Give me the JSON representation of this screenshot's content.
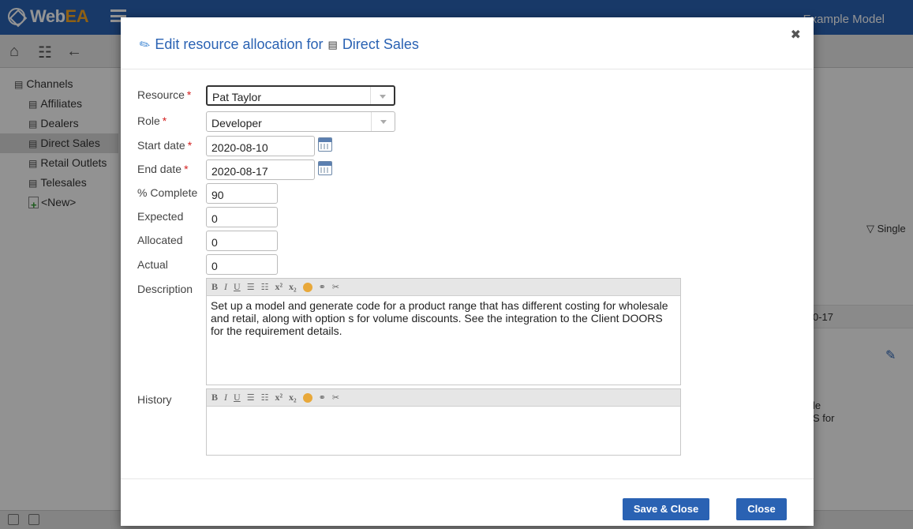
{
  "app": {
    "brand_web": "Web",
    "brand_ea": "EA",
    "model_name": "Example Model"
  },
  "tree": {
    "root": "Channels",
    "items": [
      "Affiliates",
      "Dealers",
      "Direct Sales",
      "Retail Outlets",
      "Telesales"
    ],
    "selected": "Direct Sales",
    "new_label": "<New>"
  },
  "right_pane": {
    "filter_label": "Single",
    "date_fragment": "0-17",
    "text_line1": "le",
    "text_line2": "S for"
  },
  "modal": {
    "title_prefix": "Edit resource allocation for",
    "title_element": "Direct Sales",
    "close_glyph": "✖",
    "fields": {
      "resource": {
        "label": "Resource",
        "required_mark": "*",
        "value": "Pat Taylor"
      },
      "role": {
        "label": "Role",
        "required_mark": "*",
        "value": "Developer"
      },
      "start_date": {
        "label": "Start date",
        "required_mark": "*",
        "value": "2020-08-10"
      },
      "end_date": {
        "label": "End date",
        "required_mark": "*",
        "value": "2020-08-17"
      },
      "percent_complete": {
        "label": "% Complete",
        "value": "90"
      },
      "expected": {
        "label": "Expected",
        "value": "0"
      },
      "allocated": {
        "label": "Allocated",
        "value": "0"
      },
      "actual": {
        "label": "Actual",
        "value": "0"
      },
      "description": {
        "label": "Description",
        "value": "Set up a model and generate code for a product range that has different costing for wholesale and retail, along with option s for volume discounts. See the integration to the Client DOORS for the requirement details."
      },
      "history": {
        "label": "History",
        "value": ""
      }
    },
    "editor_toolbar": {
      "bold": "B",
      "italic": "I",
      "underline": "U",
      "ordered_list": "☰",
      "bullet_list": "☷",
      "superscript": "x²",
      "subscript": "x₂",
      "link": "⚭",
      "unlink": "✂"
    },
    "buttons": {
      "save_close": "Save & Close",
      "close": "Close"
    }
  },
  "colors": {
    "accent": "#2a62b3",
    "required": "#d42020",
    "brand_ea": "#f5a623"
  }
}
